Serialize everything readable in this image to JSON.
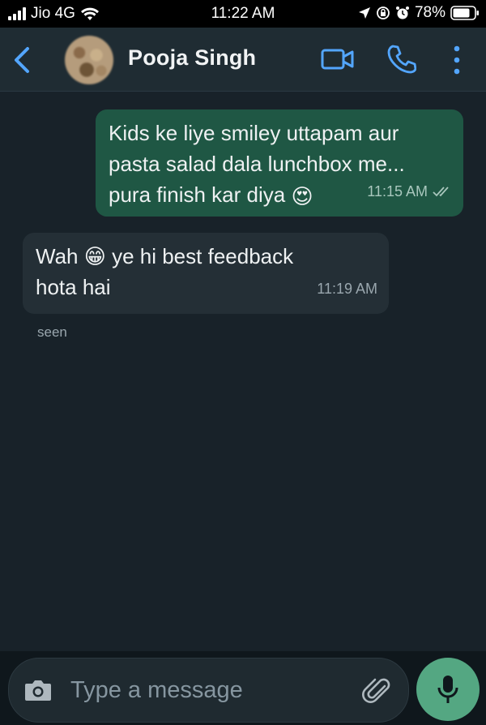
{
  "status_bar": {
    "carrier": "Jio 4G",
    "time": "11:22 AM",
    "battery": "78%"
  },
  "header": {
    "contact_name": "Pooja Singh"
  },
  "messages": [
    {
      "direction": "outgoing",
      "lines": [
        "Kids ke liye smiley uttapam aur",
        "pasta salad dala lunchbox me...",
        "pura finish kar diya"
      ],
      "emoji": "😍",
      "time": "11:15 AM",
      "status_icon": "double-check-icon"
    },
    {
      "direction": "incoming",
      "line1_before": "Wah",
      "emoji": "😁",
      "line1_after": "ye hi best feedback",
      "line2": "hota hai",
      "time": "11:19 AM"
    }
  ],
  "seen_label": "seen",
  "composer": {
    "placeholder": "Type a message"
  },
  "colors": {
    "accent": "#54a782",
    "header_icon": "#53a6ff",
    "outgoing_bubble": "#1f5744",
    "incoming_bubble": "#242f36"
  }
}
